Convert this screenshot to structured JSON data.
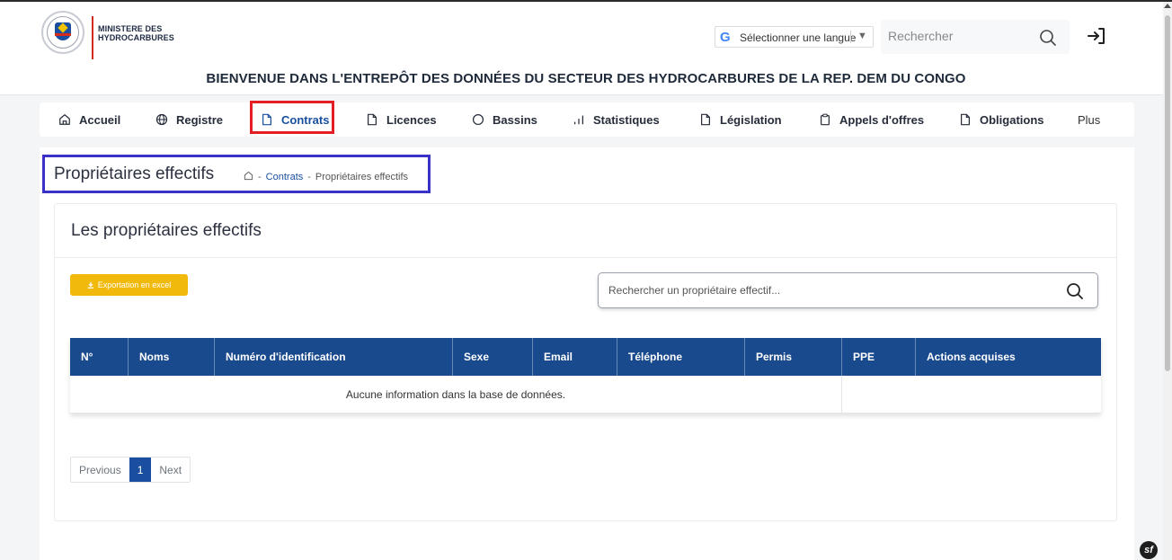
{
  "header": {
    "ministry_line1": "MINISTERE DES",
    "ministry_line2": "HYDROCARBURES",
    "language_label": "Sélectionner une langue",
    "search_placeholder": "Rechercher",
    "welcome": "BIENVENUE DANS L'ENTREPÔT DES DONNÉES DU SECTEUR DES HYDROCARBURES DE LA REP. DEM DU CONGO"
  },
  "nav": {
    "items": [
      {
        "label": "Accueil",
        "icon": "home-icon"
      },
      {
        "label": "Registre",
        "icon": "globe-icon"
      },
      {
        "label": "Contrats",
        "icon": "document-icon",
        "active": true
      },
      {
        "label": "Licences",
        "icon": "document-icon"
      },
      {
        "label": "Bassins",
        "icon": "circle-icon"
      },
      {
        "label": "Statistiques",
        "icon": "bar-chart-icon"
      },
      {
        "label": "Législation",
        "icon": "document-icon"
      },
      {
        "label": "Appels d'offres",
        "icon": "clipboard-icon"
      },
      {
        "label": "Obligations",
        "icon": "document-icon"
      }
    ],
    "more_label": "Plus"
  },
  "page": {
    "title": "Propriétaires effectifs",
    "breadcrumb_sep": "-",
    "breadcrumb_contrats": "Contrats",
    "breadcrumb_current": "Propriétaires effectifs"
  },
  "section": {
    "title": "Les propriétaires effectifs",
    "export_label": "Exportation en excel",
    "search_placeholder": "Rechercher un propriétaire effectif..."
  },
  "table": {
    "columns": [
      "N°",
      "Noms",
      "Numéro d'identification",
      "Sexe",
      "Email",
      "Téléphone",
      "Permis",
      "PPE",
      "Actions acquises"
    ],
    "empty_message": "Aucune information dans la base de données."
  },
  "pagination": {
    "previous": "Previous",
    "current": "1",
    "next": "Next"
  },
  "colors": {
    "primary": "#1a4fa0",
    "table_header": "#1a4a8e",
    "export_button": "#f0b90b",
    "highlight_red": "#e31e24",
    "highlight_blue": "#3a31c9"
  },
  "badge": "sf"
}
